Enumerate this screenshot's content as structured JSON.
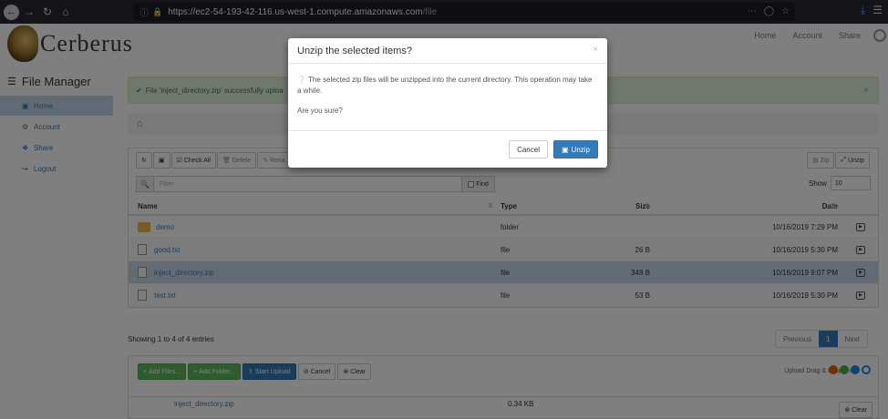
{
  "browser": {
    "url_main": "https://ec2-54-193-42-116.us-west-1.compute.amazonaws.com",
    "url_path": "/file"
  },
  "brand": {
    "name": "Cerberus"
  },
  "top_nav": [
    "Home",
    "Account",
    "Share"
  ],
  "sidebar": {
    "title": "File Manager",
    "items": [
      {
        "label": "Home",
        "icon": "folder-icon",
        "active": true
      },
      {
        "label": "Account",
        "icon": "gear-icon"
      },
      {
        "label": "Share",
        "icon": "share-icon"
      },
      {
        "label": "Logout",
        "icon": "logout-icon"
      }
    ]
  },
  "alert": {
    "text": "File 'inject_directory.zip' successfully uploa"
  },
  "toolbar": {
    "check_all": "Check All",
    "delete": "Delete",
    "rename": "Rena",
    "zip": "Zip",
    "unzip": "Unzip"
  },
  "filter": {
    "placeholder": "Filter",
    "find": "Find"
  },
  "show": {
    "label": "Show",
    "value": "10"
  },
  "table": {
    "headers": {
      "name": "Name",
      "type": "Type",
      "size": "Size",
      "date": "Date"
    },
    "rows": [
      {
        "name": "demo",
        "type": "folder",
        "size": "",
        "date": "10/16/2019 7:29 PM",
        "kind": "folder"
      },
      {
        "name": "good.txt",
        "type": "file",
        "size": "26 B",
        "date": "10/16/2019 5:30 PM",
        "kind": "file"
      },
      {
        "name": "inject_directory.zip",
        "type": "file",
        "size": "348 B",
        "date": "10/16/2019 9:07 PM",
        "kind": "file",
        "selected": true
      },
      {
        "name": "test.txt",
        "type": "file",
        "size": "53 B",
        "date": "10/16/2019 5:30 PM",
        "kind": "file"
      }
    ]
  },
  "pagination": {
    "info": "Showing 1 to 4 of 4 entries",
    "previous": "Previous",
    "current": "1",
    "next": "Next"
  },
  "upload": {
    "add_files": "Add Files...",
    "add_folder": "Add Folder...",
    "start_upload": "Start Upload",
    "cancel": "Cancel",
    "clear": "Clear",
    "dnd_text": "Upload Drag & Drop on",
    "file_name": "inject_directory.zip",
    "file_size": "0.34 KB",
    "row_clear": "Clear"
  },
  "modal": {
    "title": "Unzip the selected items?",
    "body_line": "The selected zip files will be unzipped into the current directory. This operation may take a while.",
    "question": "Are you sure?",
    "cancel": "Cancel",
    "confirm": "Unzip"
  }
}
